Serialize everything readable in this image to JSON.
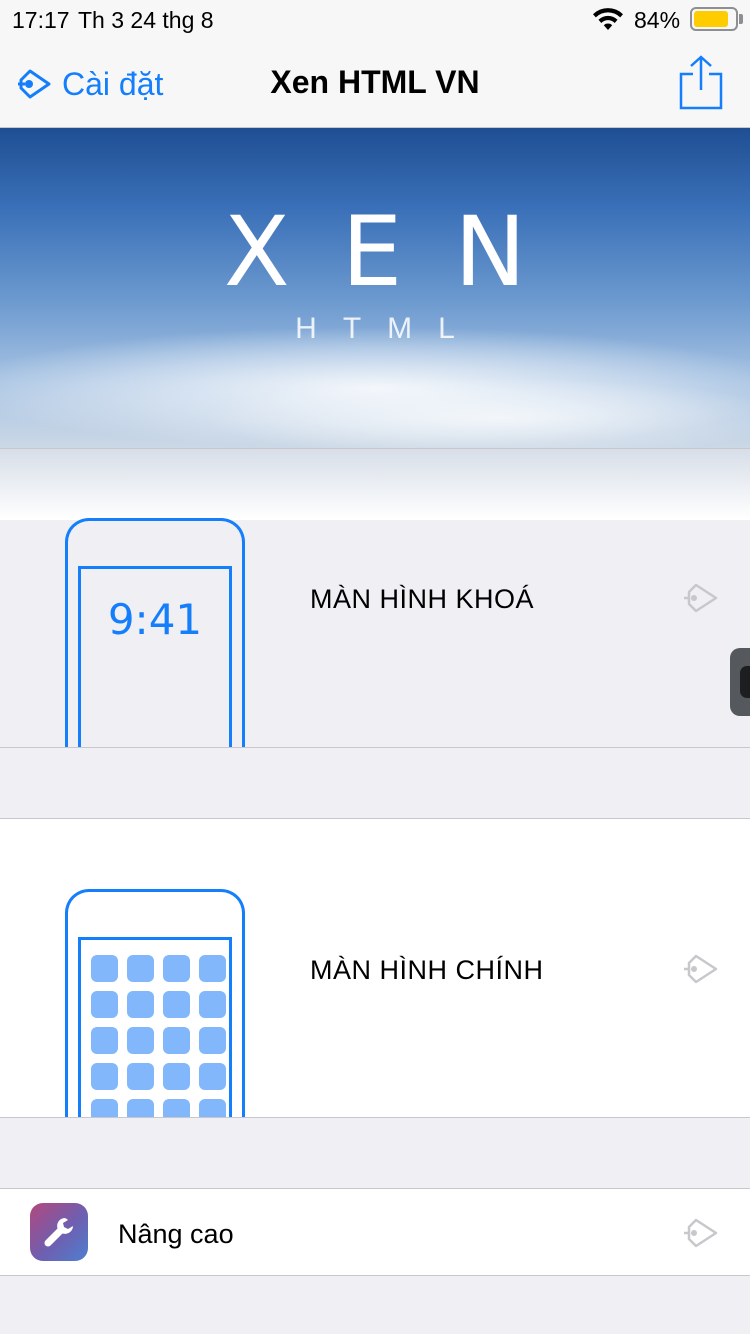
{
  "status_bar": {
    "time": "17:17",
    "date": "Th 3 24 thg 8",
    "battery_percent": "84%",
    "battery_level": 0.84,
    "wifi_icon": "wifi-icon",
    "battery_color": "#ffcc00"
  },
  "nav": {
    "back_label": "Cài đặt",
    "title": "Xen HTML VN",
    "share_icon": "share-icon"
  },
  "banner": {
    "logo_main": "XEN",
    "logo_sub": "HTML"
  },
  "sections": {
    "lockscreen": {
      "label": "MÀN HÌNH KHOÁ",
      "preview_time": "9:41"
    },
    "homescreen": {
      "label": "MÀN HÌNH CHÍNH"
    },
    "advanced": {
      "label": "Nâng cao",
      "icon": "wrench-icon"
    }
  },
  "colors": {
    "accent": "#147efb",
    "app_tile": "#82b8fb"
  }
}
